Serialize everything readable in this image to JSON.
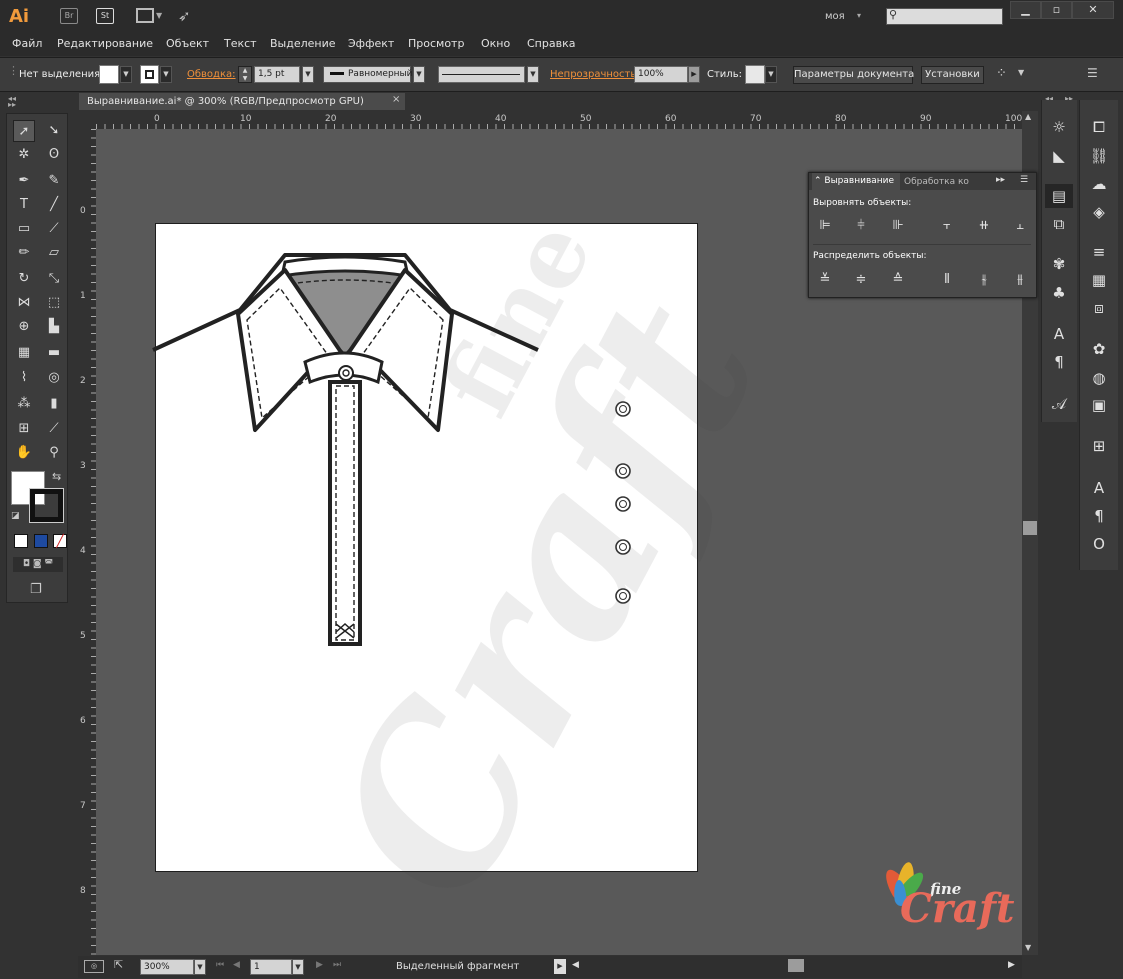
{
  "app": {
    "logo": "Ai",
    "bridge": "Br",
    "stock": "St",
    "workspace": "моя",
    "search_placeholder": ""
  },
  "menu": [
    "Файл",
    "Редактирование",
    "Объект",
    "Текст",
    "Выделение",
    "Эффект",
    "Просмотр",
    "Окно",
    "Справка"
  ],
  "control": {
    "selection": "Нет выделения",
    "stroke_label": "Обводка:",
    "stroke_weight": "1,5 pt",
    "stroke_profile": "Равномерный",
    "opacity_label": "Непрозрачность:",
    "opacity": "100%",
    "style_label": "Стиль:",
    "doc_setup": "Параметры документа",
    "prefs": "Установки"
  },
  "document": {
    "tab_title": "Выравнивание.ai* @ 300% (RGB/Предпросмотр GPU)",
    "close": "×"
  },
  "rulers": {
    "top": [
      "0",
      "10",
      "20",
      "30",
      "40",
      "50",
      "60",
      "70",
      "80",
      "90",
      "100"
    ],
    "left": [
      "0",
      "1",
      "2",
      "3",
      "4",
      "5",
      "6",
      "7",
      "8"
    ]
  },
  "status": {
    "zoom": "300%",
    "artboard": "1",
    "info": "Выделенный фрагмент"
  },
  "align_panel": {
    "tab_active": "Выравнивание",
    "tab_other": "Обработка ко",
    "align_label": "Выровнять объекты:",
    "distribute_label": "Распределить объекты:"
  },
  "watermark": {
    "word1": "fine",
    "word2": "Craft"
  },
  "logo": {
    "fine": "fine",
    "craft": "Craft"
  },
  "colors": {
    "accent": "#f0903a",
    "canvas": "#595959",
    "chrome": "#323232"
  }
}
